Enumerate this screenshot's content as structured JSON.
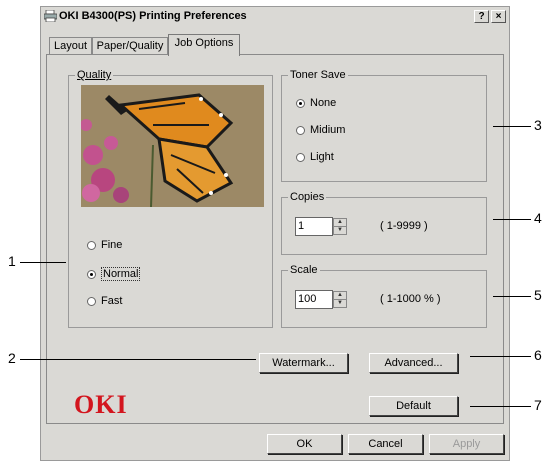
{
  "window": {
    "title": "OKI B4300(PS) Printing Preferences",
    "help_btn": "?",
    "close_btn": "×"
  },
  "tabs": [
    "Layout",
    "Paper/Quality",
    "Job Options"
  ],
  "quality": {
    "title": "Quality",
    "options": [
      "Fine",
      "Normal",
      "Fast"
    ],
    "selected": "Normal"
  },
  "toner_save": {
    "title": "Toner Save",
    "options": [
      "None",
      "Midium",
      "Light"
    ],
    "selected": "None"
  },
  "copies": {
    "title": "Copies",
    "value": "1",
    "range": "( 1-9999 )"
  },
  "scale": {
    "title": "Scale",
    "value": "100",
    "range": "( 1-1000 % )"
  },
  "buttons": {
    "watermark": "Watermark...",
    "advanced": "Advanced...",
    "default": "Default",
    "ok": "OK",
    "cancel": "Cancel",
    "apply": "Apply"
  },
  "brand": {
    "logo": "OKI",
    "color": "#d3151e"
  },
  "callouts": [
    "1",
    "2",
    "3",
    "4",
    "5",
    "6",
    "7"
  ]
}
